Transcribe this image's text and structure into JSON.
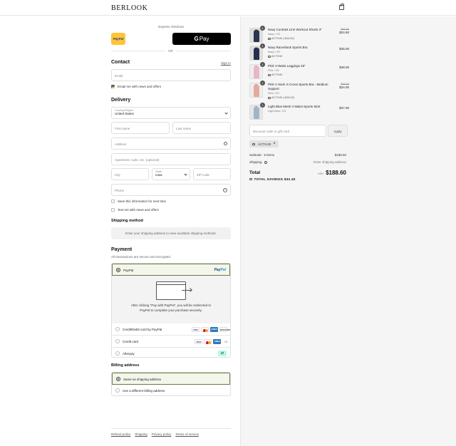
{
  "header": {
    "logo": "BERLOOK",
    "cart_icon": "bag-icon"
  },
  "express": {
    "label": "Express checkout",
    "paypal_label": "PayPal",
    "gpay_label": "Pay",
    "or": "OR"
  },
  "contact": {
    "title": "Contact",
    "sign_in": "Sign in",
    "email_placeholder": "Email",
    "news_label": "Email me with news and offers",
    "news_checked": true
  },
  "delivery": {
    "title": "Delivery",
    "country_label": "Country/Region",
    "country_value": "United States",
    "first_name": "First name",
    "last_name": "Last name",
    "address": "Address",
    "apartment": "Apartment, suite, etc. (optional)",
    "city": "City",
    "state_label": "State",
    "state_value": "Iowa",
    "zip": "ZIP code",
    "phone": "Phone",
    "save_info": "Save this information for next time",
    "text_me": "Text me with news and offers"
  },
  "shipping": {
    "title": "Shipping method",
    "placeholder": "Enter your shipping address to view available shipping methods."
  },
  "payment": {
    "title": "Payment",
    "subtitle": "All transactions are secure and encrypted.",
    "options": [
      {
        "label": "PayPal",
        "selected": true
      },
      {
        "label": "Credit/Debit card by PayPal",
        "selected": false
      },
      {
        "label": "Credit card",
        "selected": false,
        "more": "+4"
      },
      {
        "label": "Afterpay",
        "selected": false
      }
    ],
    "paypal_note": "After clicking \"Pay with PayPal\", you will be redirected to PayPal to complete your purchase securely.",
    "card_brands": [
      "VISA",
      "MC",
      "AMEX",
      "DISCOVER"
    ]
  },
  "billing": {
    "title": "Billing address",
    "options": [
      {
        "label": "Same as shipping address",
        "selected": true
      },
      {
        "label": "Use a different billing address",
        "selected": false
      }
    ]
  },
  "footer": {
    "links": [
      "Refund policy",
      "Shipping",
      "Privacy policy",
      "Terms of service"
    ]
  },
  "cart": {
    "items": [
      {
        "qty": "1",
        "name": "Navy Contrast Line Workout Shorts 3\"",
        "variant": "Navy / XS",
        "discount": "ACTIV40 (-$16.40)",
        "old_price": "$41.00",
        "price": "$24.60",
        "color": "#2b3553"
      },
      {
        "qty": "1",
        "name": "Navy Racerback Sports Bra",
        "variant": "Navy / XS",
        "discount": "ACTIV40",
        "old_price": "",
        "price": "$45.00",
        "color": "#27304a"
      },
      {
        "qty": "1",
        "name": "Pink V-Waist Leggings 26\"",
        "variant": "Pink / XS",
        "discount": "ACTIV40",
        "old_price": "",
        "price": "$48.00",
        "color": "#e9b7c4"
      },
      {
        "qty": "1",
        "name": "Pink V Neck X-Cross Sports Bra - Medium Support",
        "variant": "Pink / XS",
        "discount": "ACTIV40 (-$16.00)",
        "old_price": "$40.00",
        "price": "$24.00",
        "color": "#e6a9a0"
      },
      {
        "qty": "1",
        "name": "Light Blue Mesh V-Waist Sports Skirt",
        "variant": "Light Blue / XS",
        "discount": "",
        "old_price": "",
        "price": "$47.00",
        "color": "#9fb6c9"
      }
    ],
    "discount_placeholder": "Discount code or gift card",
    "apply": "Apply",
    "applied_code": "ACTIV40",
    "subtotal_label": "Subtotal · 5 items",
    "subtotal": "$188.60",
    "shipping_label": "Shipping",
    "shipping_value": "Enter shipping address",
    "total_label": "Total",
    "currency": "USD",
    "total": "$188.60",
    "savings_label": "TOTAL SAVINGS",
    "savings": "$32.40"
  }
}
